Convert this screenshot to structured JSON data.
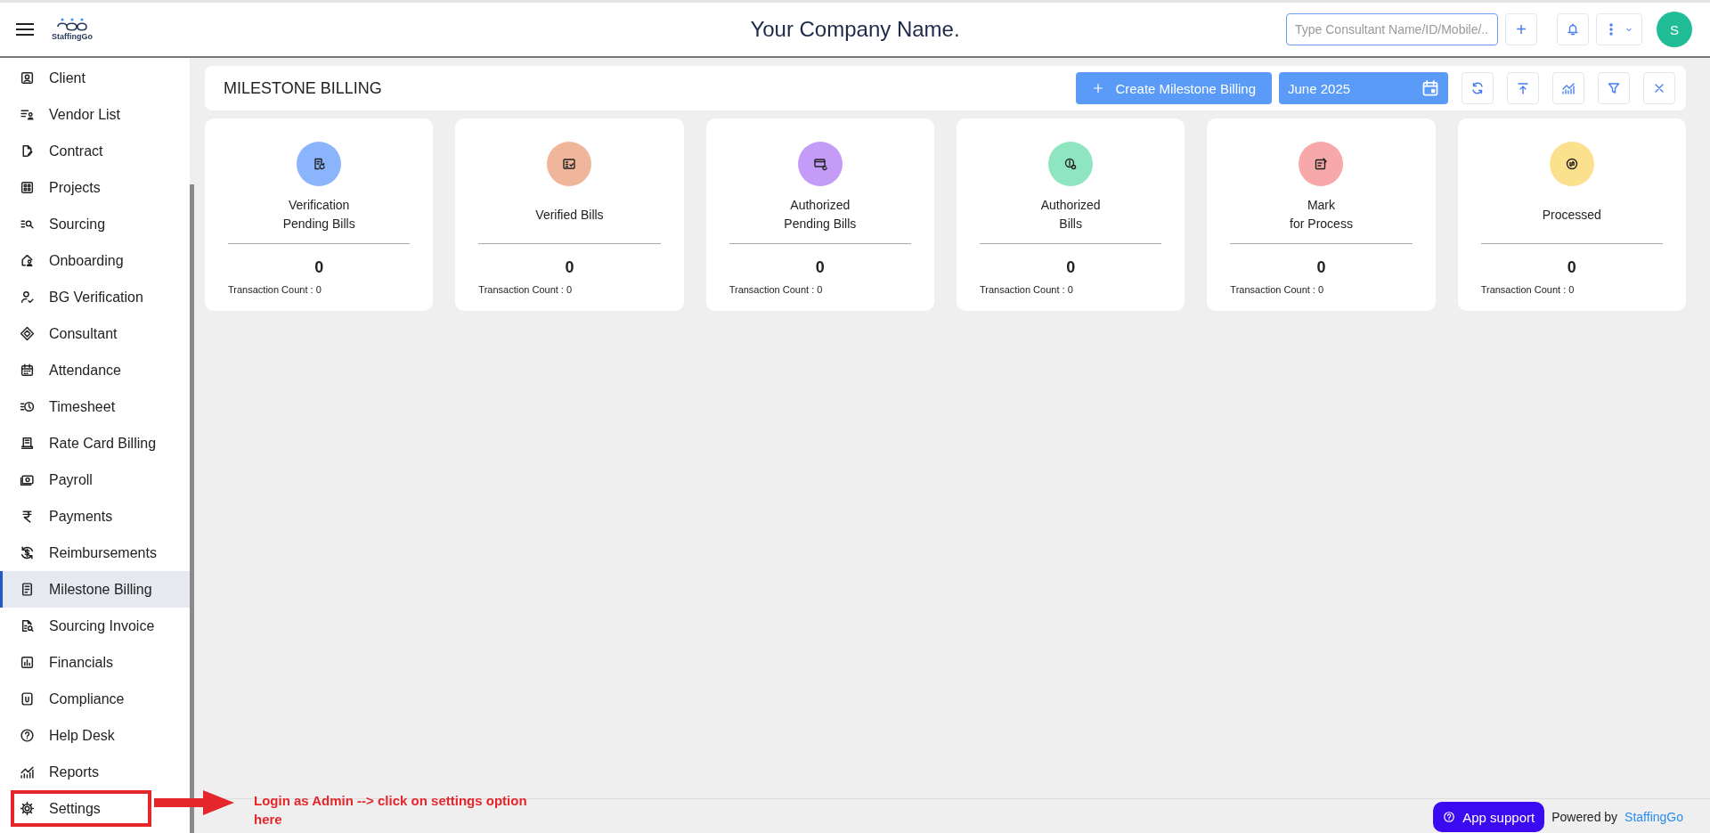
{
  "header": {
    "brand": "StaffingGo",
    "title": "Your Company Name.",
    "search": {
      "placeholder": "Type Consultant Name/ID/Mobile/..."
    },
    "add_button": "+",
    "avatar": "S"
  },
  "sidebar": {
    "items": [
      {
        "label": "Client",
        "selected": false,
        "boxed": false
      },
      {
        "label": "Vendor List",
        "selected": false,
        "boxed": false
      },
      {
        "label": "Contract",
        "selected": false,
        "boxed": false
      },
      {
        "label": "Projects",
        "selected": false,
        "boxed": false
      },
      {
        "label": "Sourcing",
        "selected": false,
        "boxed": false
      },
      {
        "label": "Onboarding",
        "selected": false,
        "boxed": false
      },
      {
        "label": "BG Verification",
        "selected": false,
        "boxed": false
      },
      {
        "label": "Consultant",
        "selected": false,
        "boxed": false
      },
      {
        "label": "Attendance",
        "selected": false,
        "boxed": false
      },
      {
        "label": "Timesheet",
        "selected": false,
        "boxed": false
      },
      {
        "label": "Rate Card Billing",
        "selected": false,
        "boxed": false
      },
      {
        "label": "Payroll",
        "selected": false,
        "boxed": false
      },
      {
        "label": "Payments",
        "selected": false,
        "boxed": false
      },
      {
        "label": "Reimbursements",
        "selected": false,
        "boxed": false
      },
      {
        "label": "Milestone Billing",
        "selected": true,
        "boxed": false
      },
      {
        "label": "Sourcing Invoice",
        "selected": false,
        "boxed": false
      },
      {
        "label": "Financials",
        "selected": false,
        "boxed": false
      },
      {
        "label": "Compliance",
        "selected": false,
        "boxed": false
      },
      {
        "label": "Help Desk",
        "selected": false,
        "boxed": false
      },
      {
        "label": "Reports",
        "selected": false,
        "boxed": false
      },
      {
        "label": "Settings",
        "selected": false,
        "boxed": true
      }
    ]
  },
  "toolbar": {
    "title": "MILESTONE BILLING",
    "create_button": "Create Milestone Billing",
    "month": "June 2025"
  },
  "cards": [
    {
      "title": "Verification\nPending Bills",
      "count": "0",
      "transactions": "Transaction Count : 0",
      "color": "#8ab4fb"
    },
    {
      "title": "Verified Bills",
      "count": "0",
      "transactions": "Transaction Count : 0",
      "color": "#f0b69c"
    },
    {
      "title": "Authorized\nPending Bills",
      "count": "0",
      "transactions": "Transaction Count : 0",
      "color": "#c49cf8"
    },
    {
      "title": "Authorized\nBills",
      "count": "0",
      "transactions": "Transaction Count : 0",
      "color": "#8ee6c0"
    },
    {
      "title": "Mark\nfor Process",
      "count": "0",
      "transactions": "Transaction Count : 0",
      "color": "#f7a8a8"
    },
    {
      "title": "Processed",
      "count": "0",
      "transactions": "Transaction Count : 0",
      "color": "#fbe08e"
    }
  ],
  "footer": {
    "support_button": "App support",
    "powered_by": "Powered by",
    "brand_link": "StaffingGo"
  },
  "annotation": {
    "text": "Login as Admin --> click on settings option here"
  }
}
